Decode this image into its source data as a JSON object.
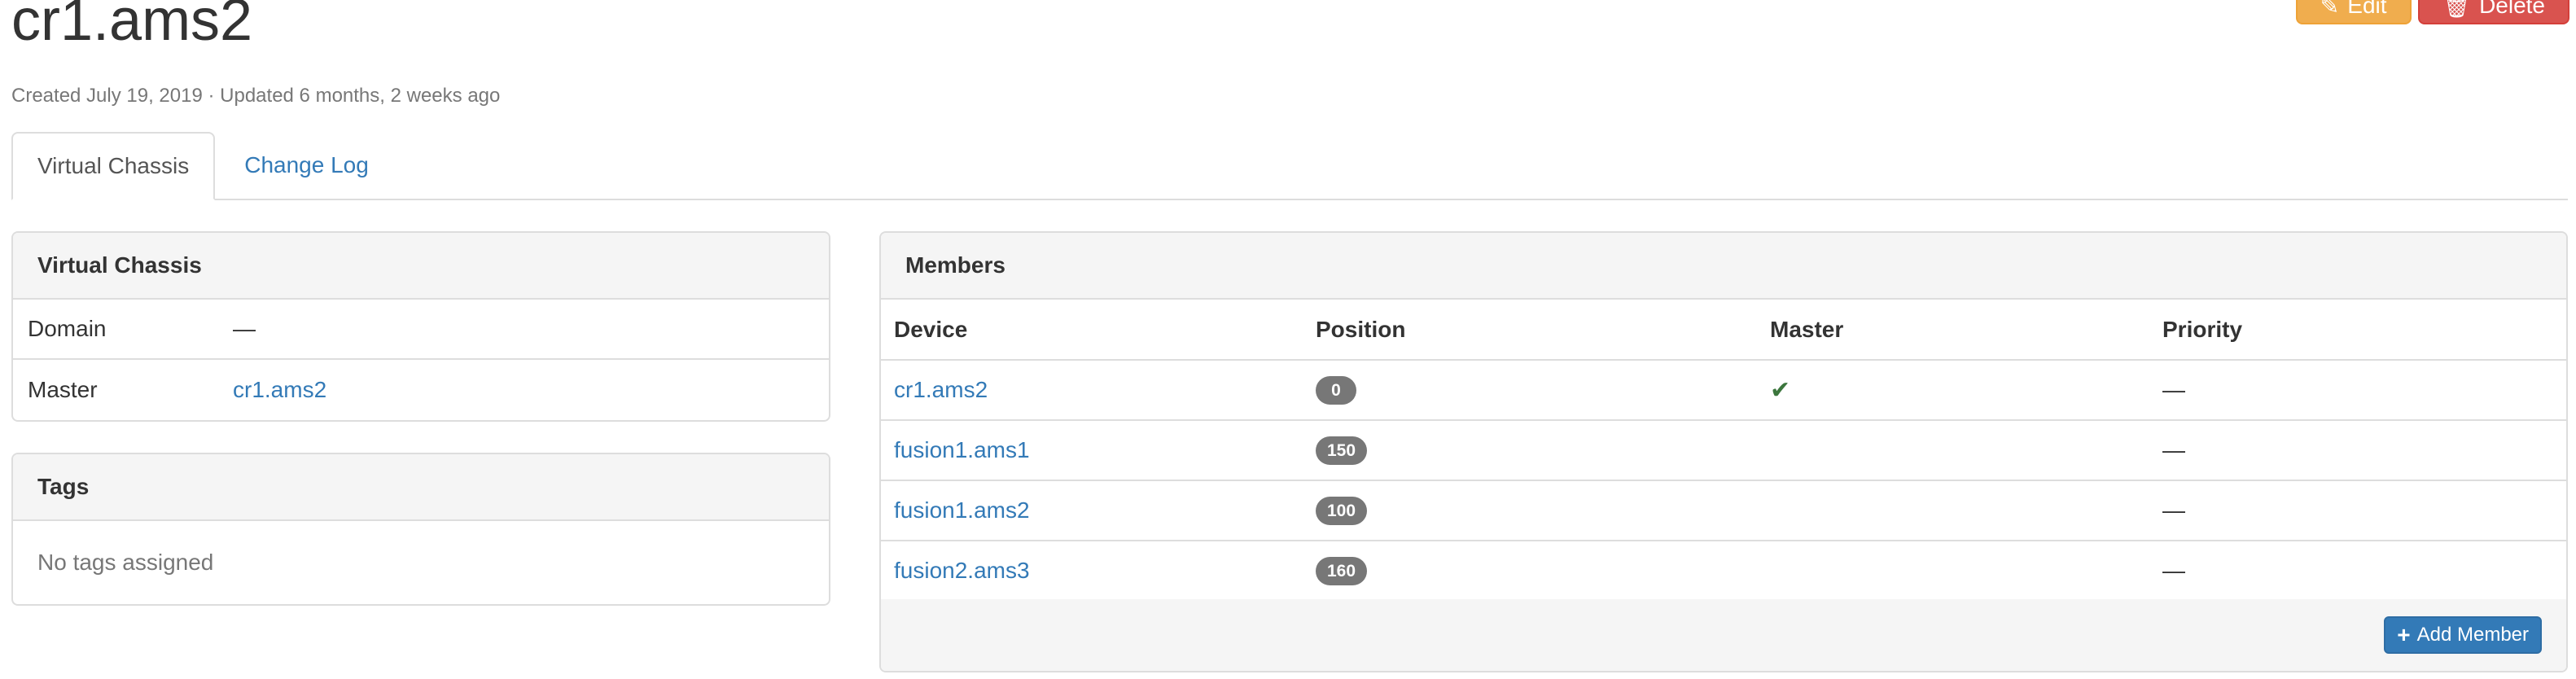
{
  "header": {
    "title": "cr1.ams2",
    "meta": "Created July 19, 2019 · Updated 6 months, 2 weeks ago",
    "edit_label": "Edit",
    "delete_label": "Delete"
  },
  "tabs": [
    {
      "label": "Virtual Chassis",
      "active": true
    },
    {
      "label": "Change Log",
      "active": false
    }
  ],
  "virtual_chassis": {
    "heading": "Virtual Chassis",
    "rows": [
      {
        "key": "Domain",
        "value": "—"
      },
      {
        "key": "Master",
        "value": "cr1.ams2"
      }
    ]
  },
  "tags": {
    "heading": "Tags",
    "empty_text": "No tags assigned"
  },
  "members": {
    "heading": "Members",
    "columns": [
      "Device",
      "Position",
      "Master",
      "Priority"
    ],
    "rows": [
      {
        "device": "cr1.ams2",
        "position": "0",
        "master": true,
        "priority": "—"
      },
      {
        "device": "fusion1.ams1",
        "position": "150",
        "master": false,
        "priority": "—"
      },
      {
        "device": "fusion1.ams2",
        "position": "100",
        "master": false,
        "priority": "—"
      },
      {
        "device": "fusion2.ams3",
        "position": "160",
        "master": false,
        "priority": "—"
      }
    ],
    "add_label": "Add Member",
    "master_icon": "check-icon",
    "master_glyph": "✔"
  },
  "colors": {
    "link": "#337ab7",
    "warning": "#f0ad4e",
    "danger": "#d9534f",
    "badge": "#777777",
    "success": "#3c763d"
  }
}
